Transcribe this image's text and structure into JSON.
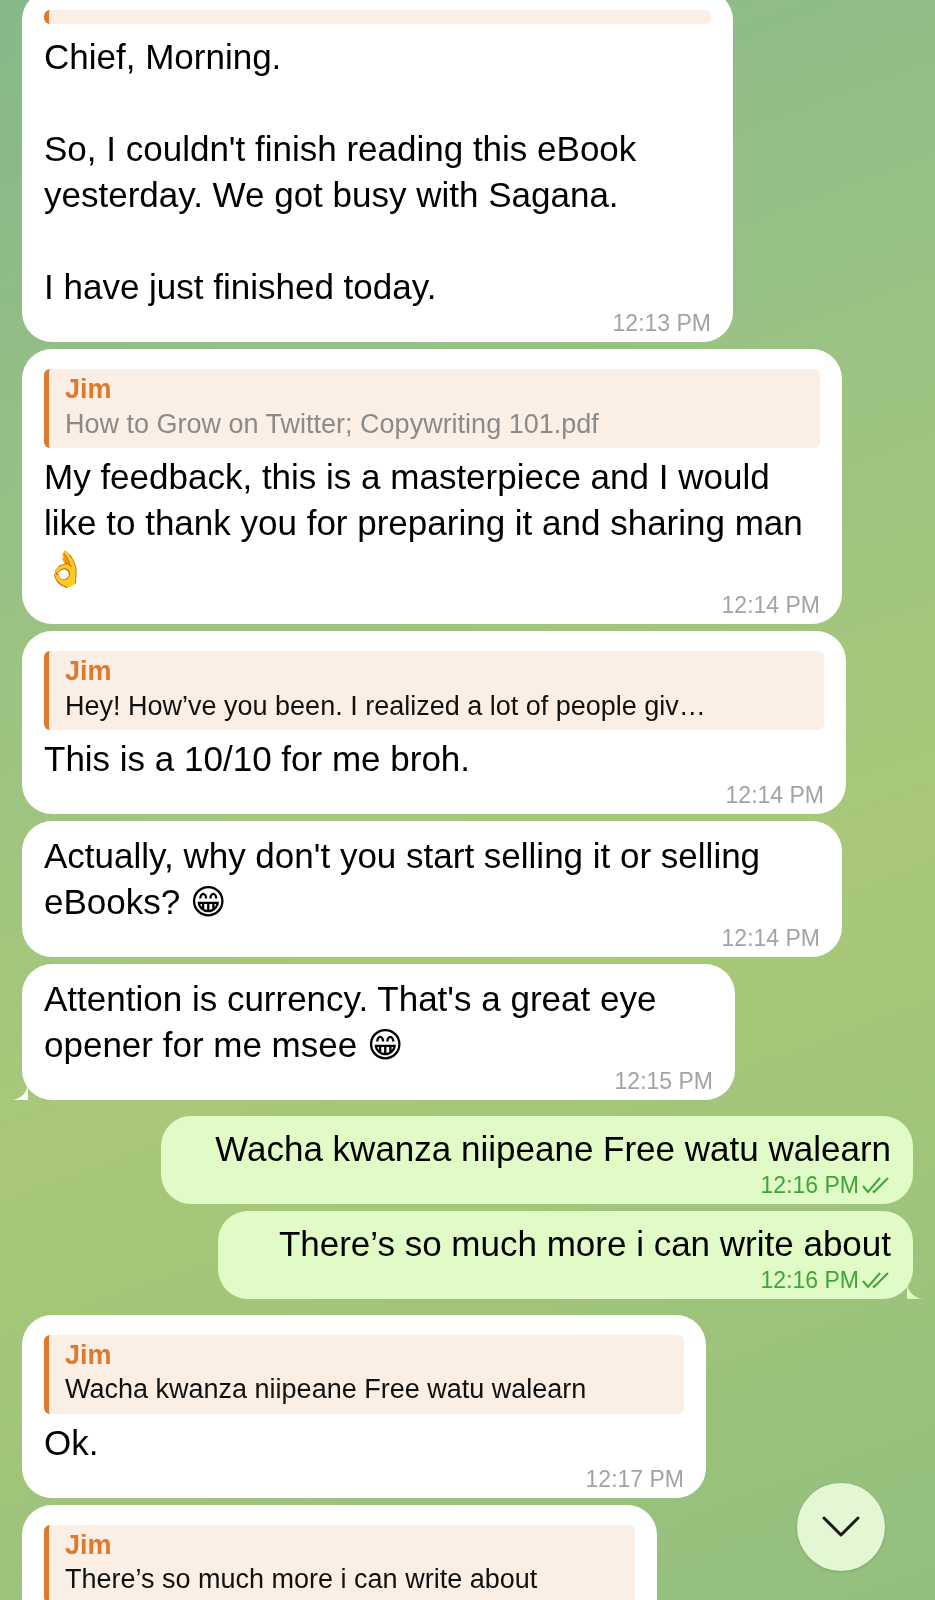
{
  "messages": [
    {
      "kind": "in",
      "reply_cut": true,
      "paragraphs": [
        "Chief, Morning.",
        "So, I couldn't finish reading this eBook yesterday. We got busy with Sagana.",
        "I have just finished today."
      ],
      "time": "12:13 PM"
    },
    {
      "kind": "in",
      "reply": {
        "name": "Jim",
        "text": "How to Grow on Twitter; Copywriting 101.pdf",
        "muted": true
      },
      "paragraphs": [
        "My feedback, this is a masterpiece and I would like to thank you for preparing it and sharing man 👌"
      ],
      "time": "12:14 PM"
    },
    {
      "kind": "in",
      "reply": {
        "name": "Jim",
        "text": "Hey! How’ve you been. I realized a lot of people giv…",
        "muted": false
      },
      "paragraphs": [
        "This is a 10/10 for me broh."
      ],
      "time": "12:14 PM"
    },
    {
      "kind": "in",
      "paragraphs": [
        "Actually, why don't you start selling it or selling eBooks? 😁"
      ],
      "time": "12:14 PM"
    },
    {
      "kind": "in",
      "tail": true,
      "paragraphs": [
        "Attention is currency. That's a great eye opener for me msee 😁"
      ],
      "time": "12:15 PM"
    },
    {
      "kind": "out",
      "read": true,
      "paragraphs": [
        "Wacha kwanza niipeane Free watu walearn"
      ],
      "time": "12:16 PM"
    },
    {
      "kind": "out",
      "read": true,
      "tail": true,
      "paragraphs": [
        "There’s so much more i can write about"
      ],
      "time": "12:16 PM"
    },
    {
      "kind": "in",
      "reply": {
        "name": "Jim",
        "text": "Wacha kwanza niipeane Free watu walearn",
        "muted": false
      },
      "paragraphs": [
        "Ok."
      ],
      "time": "12:17 PM"
    },
    {
      "kind": "in",
      "reply": {
        "name": "Jim",
        "text": "There’s so much more i can write about",
        "muted": false
      }
    }
  ]
}
